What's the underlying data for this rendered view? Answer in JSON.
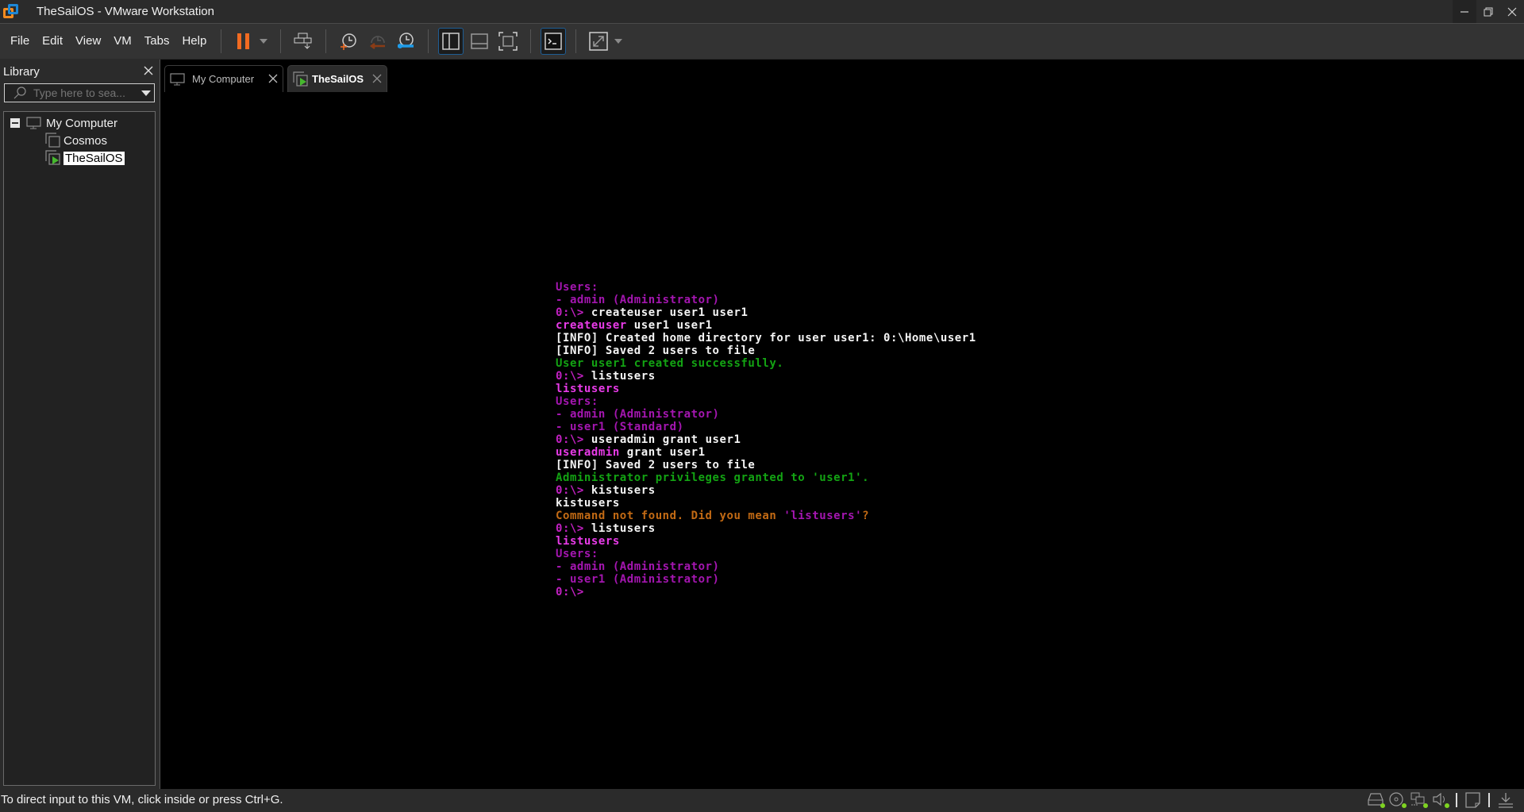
{
  "window": {
    "title": "TheSailOS - VMware Workstation",
    "controls": {
      "minimize": "minimize-icon",
      "restore": "restore-icon",
      "close": "close-icon"
    }
  },
  "menu": {
    "items": [
      {
        "label": "File"
      },
      {
        "label": "Edit"
      },
      {
        "label": "View"
      },
      {
        "label": "VM"
      },
      {
        "label": "Tabs"
      },
      {
        "label": "Help"
      }
    ]
  },
  "toolbar": {
    "buttons": [
      {
        "name": "pause-icon",
        "tooltip": "Suspend / Pause",
        "color": "#f26b21"
      },
      {
        "name": "send-ctrl-alt-del-icon"
      },
      {
        "name": "take-snapshot-icon"
      },
      {
        "name": "revert-snapshot-icon"
      },
      {
        "name": "snapshot-manager-icon"
      },
      {
        "name": "show-library-icon",
        "active": true
      },
      {
        "name": "thumbnail-bar-icon"
      },
      {
        "name": "full-screen-icon"
      },
      {
        "name": "console-view-icon",
        "active": true
      },
      {
        "name": "stretch-guest-icon"
      }
    ]
  },
  "library": {
    "title": "Library",
    "close": "×",
    "search_placeholder": "Type here to sea...",
    "tree": {
      "root": {
        "label": "My Computer",
        "expanded": true
      },
      "children": [
        {
          "label": "Cosmos",
          "running": false,
          "selected": false
        },
        {
          "label": "TheSailOS",
          "running": true,
          "selected": true
        }
      ]
    }
  },
  "tabs": [
    {
      "label": "My Computer",
      "active": false,
      "close": "✕"
    },
    {
      "label": "TheSailOS",
      "active": true,
      "close": "✕"
    }
  ],
  "console": {
    "prompt": "0:\\>",
    "lines": [
      {
        "segments": [
          {
            "text": "Users:",
            "style": "purple"
          }
        ]
      },
      {
        "segments": [
          {
            "text": "- admin (Administrator)",
            "style": "purple"
          }
        ]
      },
      {
        "segments": [
          {
            "text": "0:\\> ",
            "style": "prompt"
          },
          {
            "text": "createuser user1 user1",
            "style": "white"
          }
        ]
      },
      {
        "segments": [
          {
            "text": "createuser",
            "style": "magenta"
          },
          {
            "text": " user1 user1",
            "style": "white"
          }
        ]
      },
      {
        "segments": [
          {
            "text": "[INFO] Created home directory for user user1: 0:\\Home\\user1",
            "style": "white"
          }
        ]
      },
      {
        "segments": [
          {
            "text": "[INFO] Saved 2 users to file",
            "style": "white"
          }
        ]
      },
      {
        "segments": [
          {
            "text": "User user1 created successfully.",
            "style": "green"
          }
        ]
      },
      {
        "segments": [
          {
            "text": "0:\\> ",
            "style": "prompt"
          },
          {
            "text": "listusers",
            "style": "white"
          }
        ]
      },
      {
        "segments": [
          {
            "text": "listusers",
            "style": "magenta"
          }
        ]
      },
      {
        "segments": [
          {
            "text": "Users:",
            "style": "purple"
          }
        ]
      },
      {
        "segments": [
          {
            "text": "- admin (Administrator)",
            "style": "purple"
          }
        ]
      },
      {
        "segments": [
          {
            "text": "- user1 (Standard)",
            "style": "purple"
          }
        ]
      },
      {
        "segments": [
          {
            "text": "0:\\> ",
            "style": "prompt"
          },
          {
            "text": "useradmin grant user1",
            "style": "white"
          }
        ]
      },
      {
        "segments": [
          {
            "text": "useradmin",
            "style": "magenta"
          },
          {
            "text": " grant user1",
            "style": "white"
          }
        ]
      },
      {
        "segments": [
          {
            "text": "[INFO] Saved 2 users to file",
            "style": "white"
          }
        ]
      },
      {
        "segments": [
          {
            "text": "Administrator privileges granted to 'user1'.",
            "style": "green"
          }
        ]
      },
      {
        "segments": [
          {
            "text": "0:\\> ",
            "style": "prompt"
          },
          {
            "text": "kistusers",
            "style": "white"
          }
        ]
      },
      {
        "segments": [
          {
            "text": "kistusers",
            "style": "white"
          }
        ]
      },
      {
        "segments": [
          {
            "text": "Command not found. Did you mean ",
            "style": "orange"
          },
          {
            "text": "'listusers'",
            "style": "purple"
          },
          {
            "text": "?",
            "style": "orange"
          }
        ]
      },
      {
        "segments": [
          {
            "text": "0:\\> ",
            "style": "prompt"
          },
          {
            "text": "listusers",
            "style": "white"
          }
        ]
      },
      {
        "segments": [
          {
            "text": "listusers",
            "style": "magenta"
          }
        ]
      },
      {
        "segments": [
          {
            "text": "Users:",
            "style": "purple"
          }
        ]
      },
      {
        "segments": [
          {
            "text": "- admin (Administrator)",
            "style": "purple"
          }
        ]
      },
      {
        "segments": [
          {
            "text": "- user1 (Administrator)",
            "style": "purple"
          }
        ]
      },
      {
        "segments": [
          {
            "text": "0:\\>",
            "style": "prompt"
          }
        ]
      }
    ]
  },
  "statusbar": {
    "text": "To direct input to this VM, click inside or press Ctrl+G.",
    "devices": [
      {
        "name": "hard-disk-icon",
        "connected": true
      },
      {
        "name": "cd-dvd-icon",
        "connected": true
      },
      {
        "name": "network-adapter-icon",
        "connected": true
      },
      {
        "name": "sound-card-icon",
        "connected": true
      }
    ],
    "extra": [
      "message-log-icon",
      "install-tools-icon"
    ]
  }
}
